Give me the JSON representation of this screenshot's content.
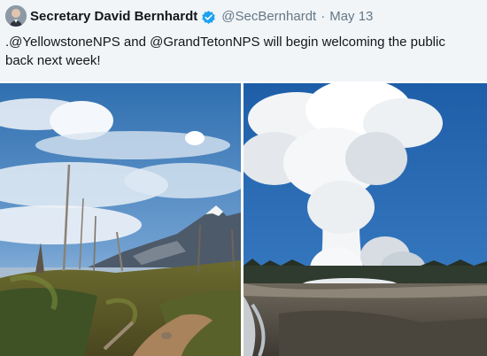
{
  "tweet": {
    "display_name": "Secretary David Bernhardt",
    "handle": "@SecBernhardt",
    "separator": "·",
    "date": "May 13",
    "text": ".@YellowstoneNPS and @GrandTetonNPS will begin welcoming the public back next week!",
    "verified_icon": "verified-badge-icon",
    "verified_color": "#1da1f2"
  },
  "media": {
    "photos": [
      {
        "subject": "mountain-lake-trail-photo"
      },
      {
        "subject": "geyser-eruption-photo"
      }
    ]
  }
}
